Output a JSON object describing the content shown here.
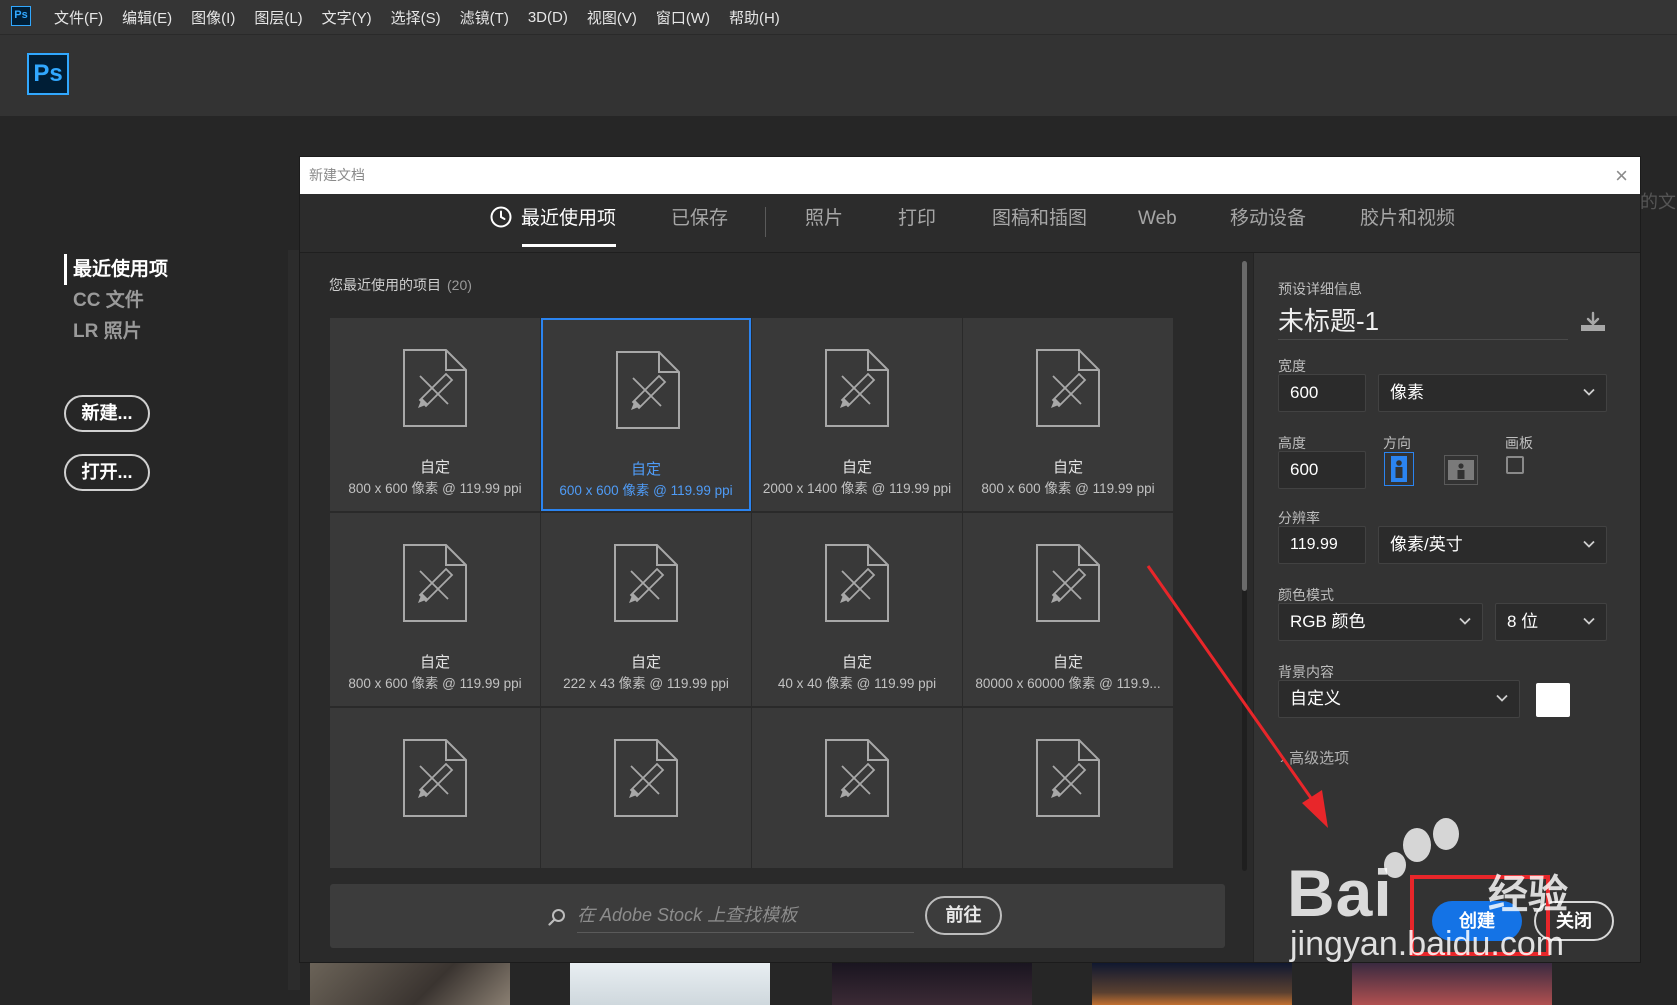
{
  "app": {
    "mini_logo": "Ps",
    "logo": "Ps",
    "menu": [
      "文件(F)",
      "编辑(E)",
      "图像(I)",
      "图层(L)",
      "文字(Y)",
      "选择(S)",
      "滤镜(T)",
      "3D(D)",
      "视图(V)",
      "窗口(W)",
      "帮助(H)"
    ]
  },
  "home": {
    "nav": [
      "最近使用项",
      "CC 文件",
      "LR 照片"
    ],
    "active_nav": "最近使用项",
    "new_button": "新建...",
    "open_button": "打开...",
    "bg_partial_text": "的文"
  },
  "dialog": {
    "title": "新建文档",
    "close_icon": "×",
    "tabs": [
      "最近使用项",
      "已保存",
      "照片",
      "打印",
      "图稿和插图",
      "Web",
      "移动设备",
      "胶片和视频"
    ],
    "active_tab": "最近使用项",
    "recent": {
      "heading": "您最近使用的项目",
      "count": "(20)",
      "selected_index": 1,
      "items": [
        {
          "name": "自定",
          "dims": "800 x 600 像素 @ 119.99 ppi"
        },
        {
          "name": "自定",
          "dims": "600 x 600 像素 @ 119.99 ppi"
        },
        {
          "name": "自定",
          "dims": "2000 x 1400 像素 @ 119.99 ppi"
        },
        {
          "name": "自定",
          "dims": "800 x 600 像素 @ 119.99 ppi"
        },
        {
          "name": "自定",
          "dims": "800 x 600 像素 @ 119.99 ppi"
        },
        {
          "name": "自定",
          "dims": "222 x 43 像素 @ 119.99 ppi"
        },
        {
          "name": "自定",
          "dims": "40 x 40 像素 @ 119.99 ppi"
        },
        {
          "name": "自定",
          "dims": "80000 x 60000 像素 @ 119.9..."
        },
        {
          "name": "",
          "dims": ""
        },
        {
          "name": "",
          "dims": ""
        },
        {
          "name": "",
          "dims": ""
        },
        {
          "name": "",
          "dims": ""
        }
      ]
    },
    "stock": {
      "placeholder": "在 Adobe Stock 上查找模板",
      "go_button": "前往"
    },
    "preset": {
      "heading": "预设详细信息",
      "doc_name": "未标题-1",
      "width_label": "宽度",
      "width_value": "600",
      "width_unit": "像素",
      "height_label": "高度",
      "height_value": "600",
      "orientation_label": "方向",
      "artboard_label": "画板",
      "artboard_checked": false,
      "resolution_label": "分辨率",
      "resolution_value": "119.99",
      "resolution_unit": "像素/英寸",
      "color_mode_label": "颜色模式",
      "color_mode": "RGB 颜色",
      "bit_depth": "8 位",
      "background_label": "背景内容",
      "background": "自定义",
      "background_color": "#ffffff",
      "advanced_label": "高级选项",
      "create_button": "创建",
      "close_button": "关闭"
    }
  },
  "watermark": {
    "logo_text": "Bai",
    "logo_cn": "经验",
    "url": "jingyan.baidu.com"
  },
  "colors": {
    "accent": "#1473e6",
    "selection": "#2b84f0",
    "ps_blue": "#31a8ff",
    "annotation_red": "#e8262a"
  }
}
